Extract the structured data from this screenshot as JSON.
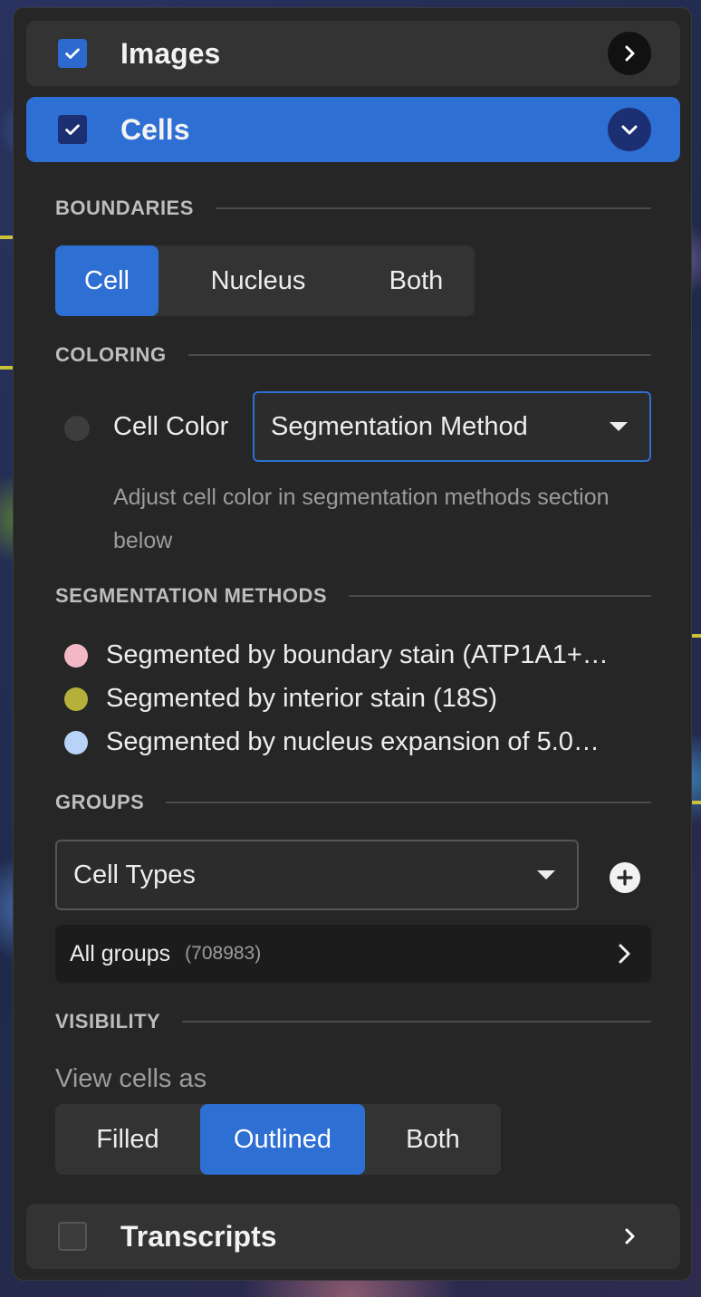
{
  "sections": {
    "images": {
      "title": "Images",
      "checked": true
    },
    "cells": {
      "title": "Cells",
      "checked": true
    },
    "transcripts": {
      "title": "Transcripts",
      "checked": false
    }
  },
  "boundaries": {
    "label": "BOUNDARIES",
    "options": [
      "Cell",
      "Nucleus",
      "Both"
    ],
    "selected": "Cell"
  },
  "coloring": {
    "label": "COLORING",
    "radio_label": "Cell Color",
    "select_value": "Segmentation Method",
    "helper": "Adjust cell color in segmentation methods section below"
  },
  "segmentation_methods": {
    "label": "SEGMENTATION METHODS",
    "items": [
      {
        "text": "Segmented by boundary stain (ATP1A1+…",
        "color": "#f2b8c6"
      },
      {
        "text": "Segmented by interior stain (18S)",
        "color": "#b5b03a"
      },
      {
        "text": "Segmented by nucleus expansion of 5.0…",
        "color": "#b9d3f8"
      }
    ]
  },
  "groups": {
    "label": "GROUPS",
    "select_value": "Cell Types",
    "all_groups": {
      "name": "All groups",
      "count": "(708983)"
    }
  },
  "visibility": {
    "label": "VISIBILITY",
    "view_as_label": "View cells as",
    "options": [
      "Filled",
      "Outlined",
      "Both"
    ],
    "selected": "Outlined"
  },
  "colors": {
    "accent": "#2e6fd3",
    "panel": "#262626",
    "header": "#333333"
  }
}
